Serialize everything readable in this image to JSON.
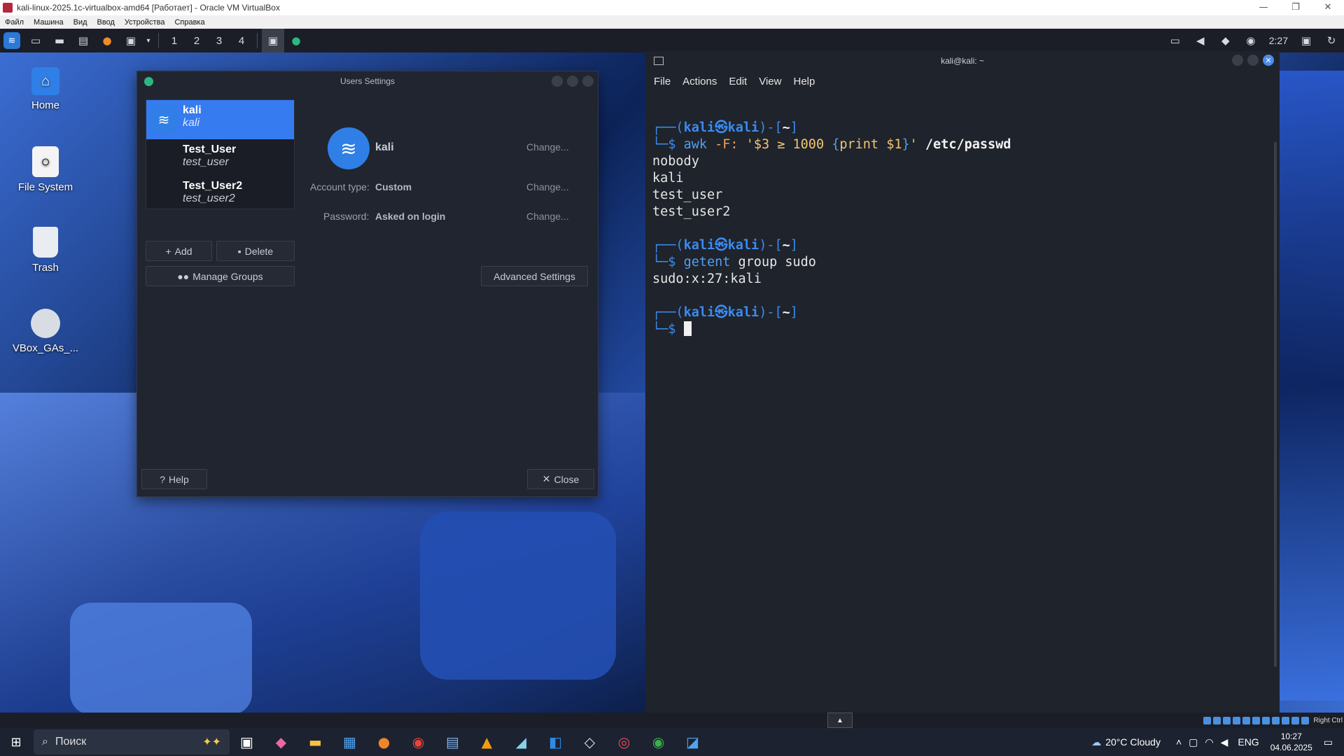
{
  "host": {
    "window_title": "kali-linux-2025.1c-virtualbox-amd64 [Работает] - Oracle VM VirtualBox",
    "menu": [
      "Файл",
      "Машина",
      "Вид",
      "Ввод",
      "Устройства",
      "Справка"
    ],
    "controls": {
      "minimize": "—",
      "restore": "❐",
      "close": "✕"
    }
  },
  "panel": {
    "workspaces": [
      "1",
      "2",
      "3",
      "4"
    ],
    "clock": "2:27",
    "launchers": [
      "kali-menu-icon",
      "desktop-icon",
      "file-manager-icon",
      "text-editor-icon",
      "firefox-icon",
      "terminal-icon"
    ]
  },
  "desktop": {
    "icons": [
      {
        "label": "Home"
      },
      {
        "label": "File System"
      },
      {
        "label": "Trash"
      },
      {
        "label": "VBox_GAs_..."
      }
    ]
  },
  "users_dialog": {
    "title": "Users Settings",
    "users": [
      {
        "name": "kali",
        "username": "kali",
        "selected": true
      },
      {
        "name": "Test_User",
        "username": "test_user",
        "selected": false
      },
      {
        "name": "Test_User2",
        "username": "test_user2",
        "selected": false
      }
    ],
    "add_label": "Add",
    "delete_label": "Delete",
    "manage_groups_label": "Manage Groups",
    "selected_name": "kali",
    "change_label": "Change...",
    "account_type_label": "Account type:",
    "account_type_value": "Custom",
    "password_label": "Password:",
    "password_value": "Asked on login",
    "advanced_label": "Advanced Settings",
    "help_label": "Help",
    "close_label": "Close"
  },
  "terminal": {
    "title": "kali@kali: ~",
    "menu": [
      "File",
      "Actions",
      "Edit",
      "View",
      "Help"
    ],
    "prompt_user": "kali",
    "prompt_host": "kali",
    "prompt_dir": "~",
    "cmd1": {
      "name": "awk",
      "args": "-F:",
      "q1": "'",
      "s1": "$3",
      "op": " ≥ ",
      "num": "1000",
      "b1": "{",
      "s2": "print $1",
      "b2": "}",
      "q2": "'",
      "path": "/etc/passwd"
    },
    "out1": [
      "nobody",
      "kali",
      "test_user",
      "test_user2"
    ],
    "cmd2": {
      "name": "getent",
      "args": "group sudo"
    },
    "out2": [
      "sudo:x:27:kali"
    ]
  },
  "vbox_status": {
    "host_key": "Right Ctrl"
  },
  "taskbar": {
    "search_placeholder": "Поиск",
    "weather": "20°C  Cloudy",
    "lang": "ENG",
    "time": "10:27",
    "date": "04.06.2025"
  }
}
